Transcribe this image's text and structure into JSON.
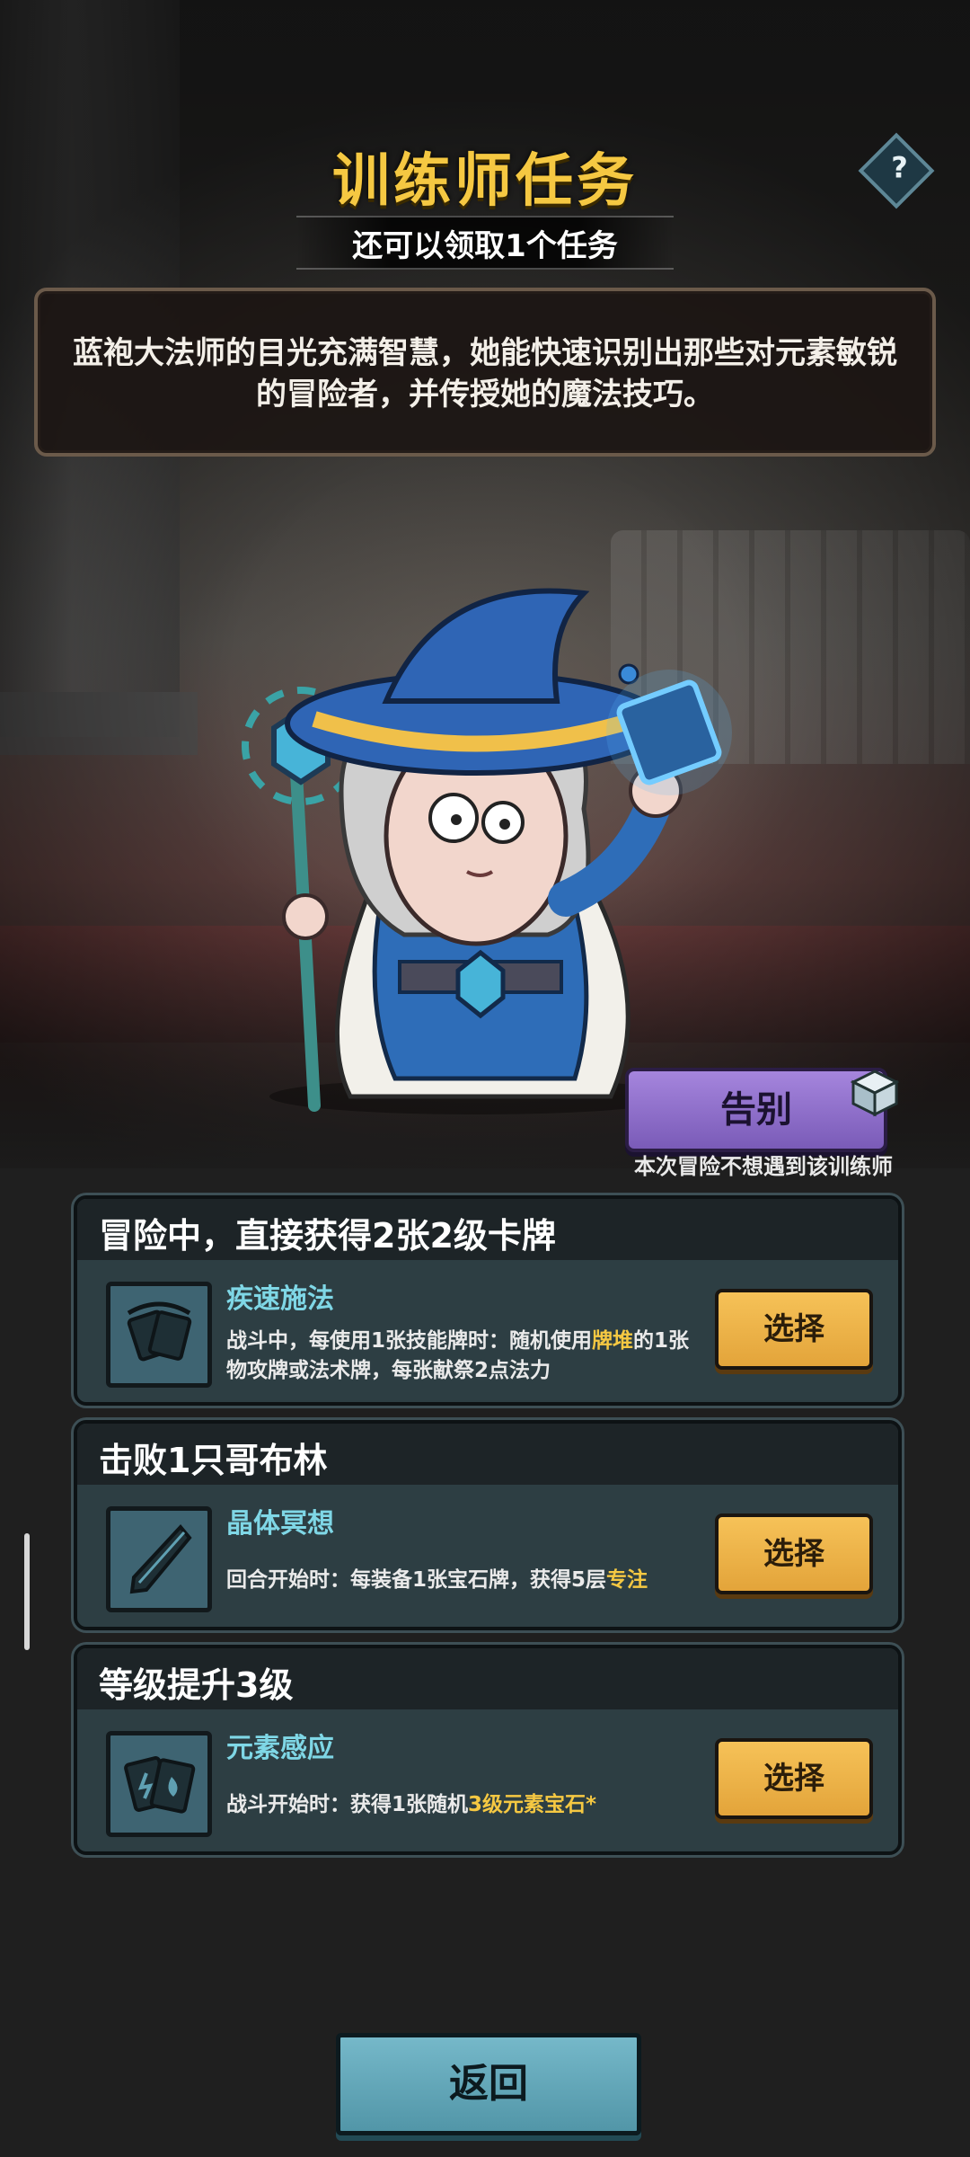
{
  "header": {
    "title": "训练师任务",
    "subtitle": "还可以领取1个任务",
    "help_label": "?"
  },
  "description": "蓝袍大法师的目光充满智慧，她能快速识别出那些对元素敏锐的冒险者，并传授她的魔法技巧。",
  "trainer": {
    "portrait": "blue-robe-archmage",
    "farewell_label": "告别",
    "farewell_note": "本次冒险不想遇到该训练师"
  },
  "tasks": [
    {
      "title": "冒险中，直接获得2张2级卡牌",
      "skill_name": "疾速施法",
      "desc_parts": [
        "战斗中，每使用1张技能牌时：随机使用",
        "牌堆",
        "的1张物攻牌或法术牌，每张献祭2点法力"
      ],
      "icon": "cards-icon",
      "select_label": "选择"
    },
    {
      "title": "击败1只哥布林",
      "skill_name": "晶体冥想",
      "desc_parts": [
        "回合开始时：每装备1张宝石牌，获得5层",
        "专注",
        ""
      ],
      "icon": "crystal-icon",
      "select_label": "选择"
    },
    {
      "title": "等级提升3级",
      "skill_name": "元素感应",
      "desc_parts": [
        "战斗开始时：获得1张随机",
        "3级元素宝石*",
        ""
      ],
      "icon": "element-cards-icon",
      "select_label": "选择"
    }
  ],
  "footer": {
    "back_label": "返回"
  },
  "colors": {
    "title": "#f5c842",
    "skill_name": "#7fd7e6",
    "highlight": "#f5c842",
    "select_button": "#f0b84c",
    "back_button": "#66a9bb",
    "farewell_button": "#9174cc"
  }
}
